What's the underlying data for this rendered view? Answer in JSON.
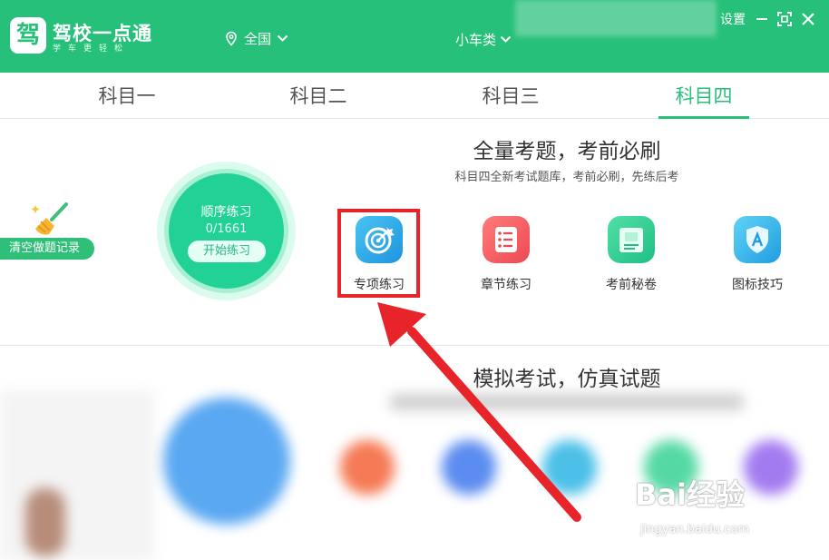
{
  "header": {
    "app_title": "驾校一点通",
    "app_subtitle": "学车更轻松",
    "logo_glyph": "驾",
    "location": "全国",
    "car_type": "小车类",
    "settings": "设置"
  },
  "tabs": [
    {
      "label": "科目一"
    },
    {
      "label": "科目二"
    },
    {
      "label": "科目三"
    },
    {
      "label": "科目四"
    }
  ],
  "active_tab": "科目四",
  "section1": {
    "title": "全量考题，考前必刷",
    "subtitle": "科目四全新考试题库，考前必刷，先练后考"
  },
  "sequence": {
    "title": "顺序练习",
    "count": "0/1661",
    "button": "开始练习"
  },
  "clear_record": "清空做题记录",
  "features": [
    {
      "label": "专项练习",
      "icon": "target-icon",
      "color": "#2fa9e6"
    },
    {
      "label": "章节练习",
      "icon": "list-icon",
      "color": "#f1585c"
    },
    {
      "label": "考前秘卷",
      "icon": "scroll-icon",
      "color": "#2cc98d"
    },
    {
      "label": "图标技巧",
      "icon": "shield-a-icon",
      "color": "#2fa9e6"
    }
  ],
  "section2": {
    "title": "模拟考试，仿真试题"
  },
  "watermark": {
    "text": "Bai经验",
    "url": "jingyan.baidu.com"
  },
  "colors": {
    "brand_green": "#27c07a",
    "highlight_red": "#e8242b"
  }
}
